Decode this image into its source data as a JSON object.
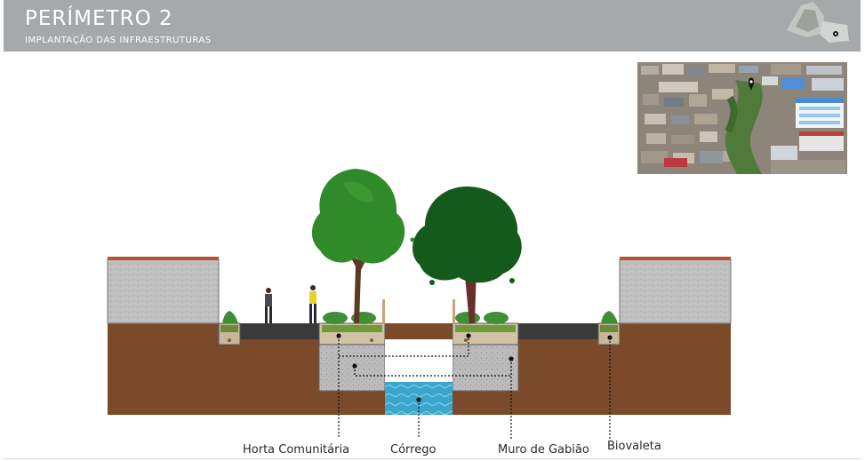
{
  "header": {
    "title": "PERÍMETRO 2",
    "subtitle": "IMPLANTAÇÃO DAS INFRAESTRUTURAS"
  },
  "section_labels": {
    "horta": "Horta Comunitária",
    "corrego": "Córrego",
    "muro": "Muro de Gabião",
    "biovaleta": "Biovaleta"
  },
  "icons": {
    "locator": "map-locator-icon",
    "pin": "location-pin-icon"
  },
  "colors": {
    "header_bg": "#a6a8aa",
    "soil": "#7a4a2a",
    "water": "#3aa6cc",
    "gabion": "#b8b8b8",
    "wall": "#bdbdbd",
    "tree_light": "#2f8a2a",
    "tree_dark": "#145a1a"
  }
}
